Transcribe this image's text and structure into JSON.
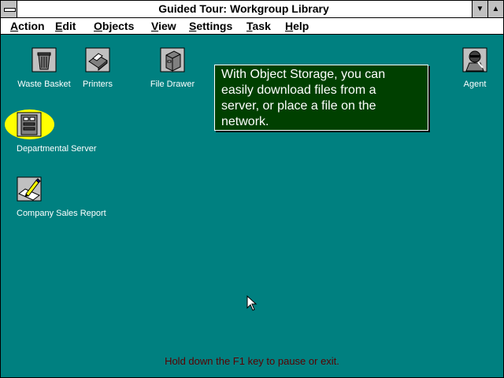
{
  "window": {
    "title": "Guided Tour: Workgroup Library",
    "min_glyph": "▼",
    "max_glyph": "▲"
  },
  "menubar": {
    "items": [
      {
        "label": "Action",
        "accel": "A",
        "rest": "ction"
      },
      {
        "label": "Edit",
        "accel": "E",
        "rest": "dit"
      },
      {
        "label": "Objects",
        "accel": "O",
        "rest": "bjects"
      },
      {
        "label": "View",
        "accel": "V",
        "rest": "iew"
      },
      {
        "label": "Settings",
        "accel": "S",
        "rest": "ettings"
      },
      {
        "label": "Task",
        "accel": "T",
        "rest": "ask"
      },
      {
        "label": "Help",
        "accel": "H",
        "rest": "elp"
      }
    ]
  },
  "icons": {
    "waste_basket": {
      "label": "Waste Basket",
      "icon": "waste-basket-icon"
    },
    "printers": {
      "label": "Printers",
      "icon": "printer-icon"
    },
    "file_drawer": {
      "label": "File Drawer",
      "icon": "file-drawer-icon"
    },
    "agent": {
      "label": "Agent",
      "icon": "agent-icon"
    },
    "departmental_server": {
      "label": "Departmental Server",
      "icon": "server-icon"
    },
    "company_sales_report": {
      "label": "Company Sales Report",
      "icon": "report-icon"
    }
  },
  "tooltip": {
    "lines": [
      "With Object Storage, you can",
      "easily download files from a",
      "server, or place a file on the",
      "network."
    ]
  },
  "status": {
    "text": "Hold down the F1 key to pause or exit."
  },
  "colors": {
    "desktop": "#008080",
    "tooltip_bg": "#004000",
    "highlight": "#ffff00",
    "status_text": "#5a0000"
  }
}
